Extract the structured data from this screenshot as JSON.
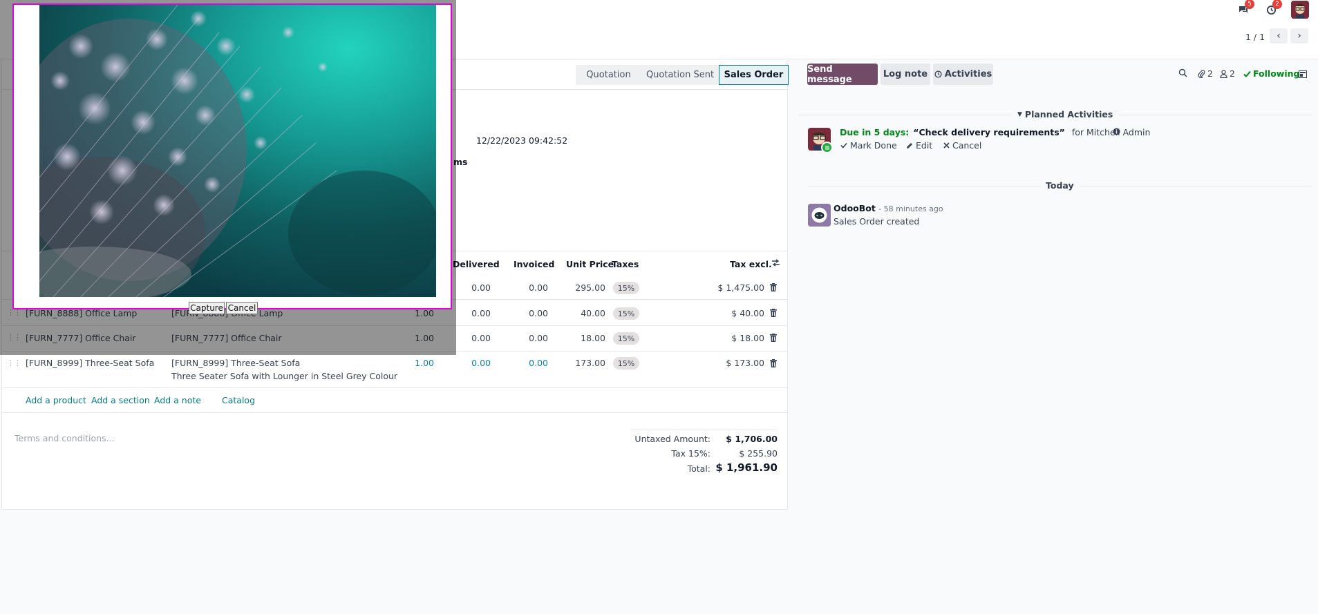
{
  "topbar": {
    "messages_badge": "5",
    "activities_badge": "2"
  },
  "pager": {
    "text": "1 / 1"
  },
  "statusbar": {
    "stages": [
      "Quotation",
      "Quotation Sent",
      "Sales Order"
    ],
    "active_stage": "Sales Order"
  },
  "form": {
    "order_date": "12/22/2023 09:42:52",
    "terms_fragment": "ms"
  },
  "order_lines": {
    "headers": {
      "delivered": "Delivered",
      "invoiced": "Invoiced",
      "unit_price": "Unit Price",
      "taxes": "Taxes",
      "tax_excl": "Tax excl."
    },
    "rows": [
      {
        "product": "",
        "description": "",
        "qty": "",
        "delivered": "0.00",
        "invoiced": "0.00",
        "unit_price": "295.00",
        "tax": "15%",
        "subtotal": "$ 1,475.00"
      },
      {
        "product": "[FURN_8888] Office Lamp",
        "description": "[FURN_8888] Office Lamp",
        "qty": "1.00",
        "delivered": "0.00",
        "invoiced": "0.00",
        "unit_price": "40.00",
        "tax": "15%",
        "subtotal": "$ 40.00"
      },
      {
        "product": "[FURN_7777] Office Chair",
        "description": "[FURN_7777] Office Chair",
        "qty": "1.00",
        "delivered": "0.00",
        "invoiced": "0.00",
        "unit_price": "18.00",
        "tax": "15%",
        "subtotal": "$ 18.00"
      },
      {
        "product": "[FURN_8999] Three-Seat Sofa",
        "description": "[FURN_8999] Three-Seat Sofa",
        "description2": "Three Seater Sofa with Lounger in Steel Grey Colour",
        "qty": "1.00",
        "delivered": "0.00",
        "invoiced": "0.00",
        "unit_price": "173.00",
        "tax": "15%",
        "subtotal": "$ 173.00"
      }
    ],
    "add_product": "Add a product",
    "add_section": "Add a section",
    "add_note": "Add a note",
    "catalog": "Catalog"
  },
  "footer": {
    "terms_placeholder": "Terms and conditions...",
    "untaxed_label": "Untaxed Amount:",
    "untaxed_value": "$ 1,706.00",
    "tax_label": "Tax 15%:",
    "tax_value": "$ 255.90",
    "total_label": "Total:",
    "total_value": "$ 1,961.90"
  },
  "chatter": {
    "send_message": "Send message",
    "log_note": "Log note",
    "activities": "Activities",
    "attachments_count": "2",
    "followers_count": "2",
    "following": "Following",
    "planned_activities": "Planned Activities",
    "activity": {
      "due": "Due in 5 days:",
      "summary": "“Check delivery requirements”",
      "for": "for Mitchell Admin",
      "mark_done": "Mark Done",
      "edit": "Edit",
      "cancel": "Cancel"
    },
    "today": "Today",
    "message": {
      "author": "OdooBot",
      "time": "- 58 minutes ago",
      "body": "Sales Order created"
    }
  },
  "capture_dialog": {
    "capture": "Capture",
    "cancel": "Cancel"
  },
  "colors": {
    "primary": "#714b67",
    "link": "#017e84",
    "following": "#008818",
    "badge": "#e4403b",
    "capture_border": "#e000e0"
  }
}
